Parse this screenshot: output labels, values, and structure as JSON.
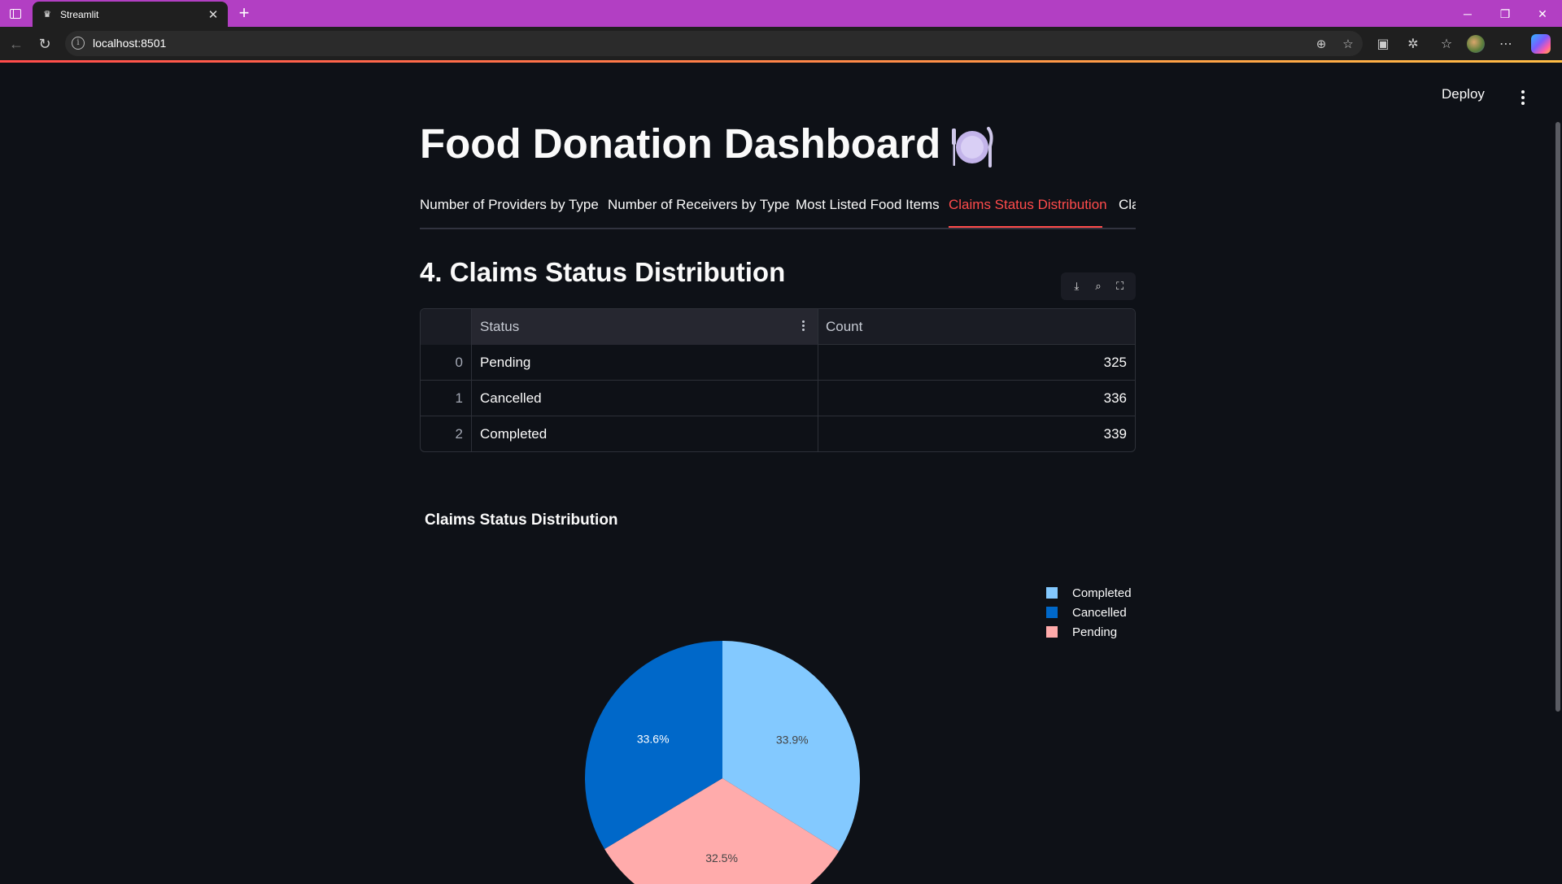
{
  "browser": {
    "tab_title": "Streamlit",
    "url": "localhost:8501"
  },
  "header": {
    "deploy_label": "Deploy"
  },
  "page": {
    "title": "Food Donation Dashboard",
    "title_emoji_icon": "plate-with-cutlery-icon"
  },
  "tabs": [
    {
      "label": "Number of Providers by Type",
      "active": false
    },
    {
      "label": "Number of Receivers by Type",
      "active": false
    },
    {
      "label": "Most Listed Food Items",
      "active": false
    },
    {
      "label": "Claims Status Distribution",
      "active": true
    },
    {
      "label": "Cla",
      "active": false
    }
  ],
  "section": {
    "title": "4. Claims Status Distribution"
  },
  "dataframe": {
    "columns": [
      "Status",
      "Count"
    ],
    "rows": [
      {
        "index": "0",
        "status": "Pending",
        "count": "325"
      },
      {
        "index": "1",
        "status": "Cancelled",
        "count": "336"
      },
      {
        "index": "2",
        "status": "Completed",
        "count": "339"
      }
    ]
  },
  "chart_data": {
    "type": "pie",
    "title": "Claims Status Distribution",
    "slices": [
      {
        "label": "Completed",
        "value": 339,
        "percent_label": "33.9%",
        "color": "#83c9ff"
      },
      {
        "label": "Pending",
        "value": 325,
        "percent_label": "32.5%",
        "color": "#ffabab"
      },
      {
        "label": "Cancelled",
        "value": 336,
        "percent_label": "33.6%",
        "color": "#0068c9"
      }
    ],
    "legend": [
      "Completed",
      "Cancelled",
      "Pending"
    ],
    "legend_placement": "top-right"
  },
  "colors": {
    "background": "#0e1117",
    "accent": "#ff4b4b",
    "browser_frame": "#b23fc3"
  }
}
